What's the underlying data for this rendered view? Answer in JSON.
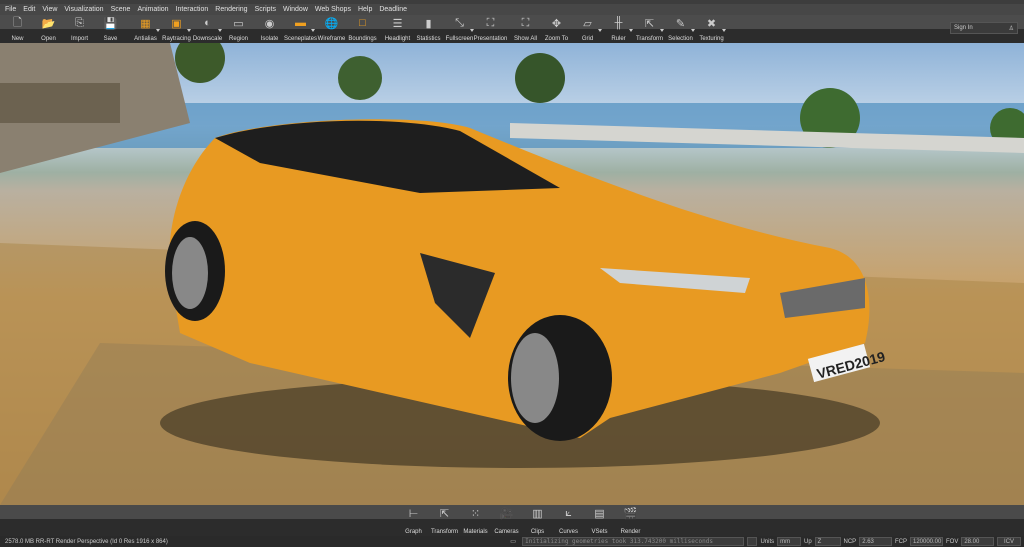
{
  "menu": [
    "File",
    "Edit",
    "View",
    "Visualization",
    "Scene",
    "Animation",
    "Interaction",
    "Rendering",
    "Scripts",
    "Window",
    "Web Shops",
    "Help",
    "Deadline"
  ],
  "toolbar": [
    {
      "label": "New",
      "icon": "file-icon",
      "glyph": "🗋"
    },
    {
      "label": "Open",
      "icon": "folder-icon",
      "glyph": "📂"
    },
    {
      "label": "Import",
      "icon": "import-icon",
      "glyph": "⎘"
    },
    {
      "label": "Save",
      "icon": "save-icon",
      "glyph": "💾"
    },
    {
      "label": "Antialias",
      "icon": "antialias-icon",
      "glyph": "▦",
      "dd": true
    },
    {
      "label": "Raytracing",
      "icon": "gpu-icon",
      "glyph": "▣",
      "dd": true
    },
    {
      "label": "Downscale",
      "icon": "downscale-icon",
      "glyph": "◐",
      "dd": true
    },
    {
      "label": "Region",
      "icon": "region-icon",
      "glyph": "▭"
    },
    {
      "label": "Isolate",
      "icon": "isolate-icon",
      "glyph": "◉"
    },
    {
      "label": "Sceneplates",
      "icon": "sceneplates-icon",
      "glyph": "▬",
      "dd": true
    },
    {
      "label": "Wireframe",
      "icon": "wireframe-icon",
      "glyph": "🌐"
    },
    {
      "label": "Boundings",
      "icon": "boundings-icon",
      "glyph": "□"
    },
    {
      "label": "Headlight",
      "icon": "headlight-icon",
      "glyph": "☰"
    },
    {
      "label": "Statistics",
      "icon": "statistics-icon",
      "glyph": "▮"
    },
    {
      "label": "Fullscreen",
      "icon": "fullscreen-icon",
      "glyph": "⤡",
      "dd": true
    },
    {
      "label": "Presentation",
      "icon": "presentation-icon",
      "glyph": "⛶"
    },
    {
      "label": "Show All",
      "icon": "show-all-icon",
      "glyph": "⛶"
    },
    {
      "label": "Zoom To",
      "icon": "zoom-to-icon",
      "glyph": "✥"
    },
    {
      "label": "Grid",
      "icon": "grid-icon",
      "glyph": "▱",
      "dd": true
    },
    {
      "label": "Ruler",
      "icon": "ruler-icon",
      "glyph": "╫",
      "dd": true
    },
    {
      "label": "Transform",
      "icon": "transform-icon",
      "glyph": "⇱",
      "dd": true
    },
    {
      "label": "Selection",
      "icon": "selection-icon",
      "glyph": "✎",
      "dd": true
    },
    {
      "label": "Texturing",
      "icon": "texturing-icon",
      "glyph": "✖",
      "dd": true
    }
  ],
  "signin": "Sign In",
  "bottom": [
    {
      "label": "Graph",
      "icon": "graph-icon",
      "glyph": "⊢"
    },
    {
      "label": "Transform",
      "icon": "transform-icon",
      "glyph": "⇱"
    },
    {
      "label": "Materials",
      "icon": "materials-icon",
      "glyph": "⁙"
    },
    {
      "label": "Cameras",
      "icon": "camera-icon",
      "glyph": "🎥"
    },
    {
      "label": "Clips",
      "icon": "clips-icon",
      "glyph": "▥"
    },
    {
      "label": "Curves",
      "icon": "curves-icon",
      "glyph": "⟀"
    },
    {
      "label": "VSets",
      "icon": "vsets-icon",
      "glyph": "▤"
    },
    {
      "label": "Render",
      "icon": "render-icon",
      "glyph": "🎬"
    }
  ],
  "status": {
    "info": "2578.0 MB  RR-RT  Render Perspective (Id 0 Res 1916 x 864)",
    "log": "Initializing geometries took 313.743200 milliseconds",
    "units_label": "Units",
    "units": "mm",
    "up_label": "Up",
    "up": "Z",
    "ncp_label": "NCP",
    "ncp": "2.63",
    "fcp_label": "FCP",
    "fcp": "120000.00",
    "fov_label": "FOV",
    "fov": "28.00",
    "icv": "ICV"
  },
  "plate": "VRED2019"
}
